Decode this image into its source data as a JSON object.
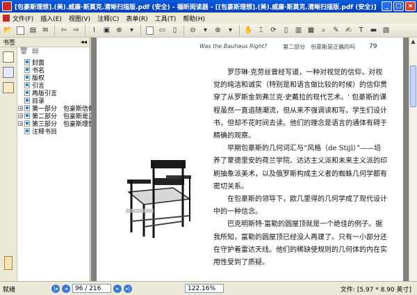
{
  "window": {
    "title": "[包豪斯理想].(美).威廉·斯莫克.清晰扫描版.pdf (安全) - 福昕阅读器 - [[包豪斯理想].(美).威廉·斯莫克.清晰扫描版.pdf (安全)]",
    "minimize": "_",
    "maximize": "□",
    "close": "×"
  },
  "menu": [
    "文件(F)",
    "插入(E)",
    "视图(V)",
    "注释(C)",
    "表单(R)",
    "工具(T)",
    "帮助(H)"
  ],
  "sidebar": {
    "title": "书签",
    "collapse": "◂◂",
    "items": [
      {
        "label": "封面",
        "expandable": false
      },
      {
        "label": "书名",
        "expandable": false
      },
      {
        "label": "版权",
        "expandable": false
      },
      {
        "label": "引言",
        "expandable": false
      },
      {
        "label": "再版引言",
        "expandable": false
      },
      {
        "label": "目录",
        "expandable": false
      },
      {
        "label": "第一部分　包豪斯信仰",
        "expandable": true
      },
      {
        "label": "第二部分　包豪斯是正",
        "expandable": true
      },
      {
        "label": "第三部分　包豪斯理想",
        "expandable": true
      },
      {
        "label": "注释书目",
        "expandable": false
      }
    ]
  },
  "page": {
    "header_en": "Was the Bauhaus Right?",
    "header_section": "第二部分　包豪斯是正确的吗",
    "page_number": "79",
    "paragraphs": [
      "罗莎琳·克劳丝曾经写道，一种对视觉的信仰，对视觉的纯洁和诚实（特别是和语言做比较的时候）的信仰贯穿了从罗斯金到弗兰克·史戴拉的现代艺术。' 包豪斯的课程虽然一直追随潮流，但从来不强调读和写。学生们设计书，但却不花时间去读。他们的理念是语言的通体有碍于精确的观察。",
      "早期包豪斯的几何词汇与“风格（de Stijl）”——培养了蒙德里安的荷兰学院、达达主义派和未来主义派的印刷抽象派美术，以及俄罗斯构成主义者的蜘蛛几何学都有密切关系。",
      "在包豪斯的领导下，欧几里得的几何学成了现代设计中的一种信念。",
      "巴克明斯特·富勒的圆屋顶就是一个绝佳的例子。据我所知，富勒的圆屋顶已经没人再建了。只有一小部分还在守护着雷达天线。他们的稀缺使规则的几何体的内在实用性受到了质疑。"
    ]
  },
  "status": {
    "ready": "就绪",
    "page_indicator": "96 / 216",
    "zoom": "122.16%",
    "doc_size": "文件: [5.97 * 8.90 英寸]"
  },
  "nav_buttons": {
    "first": "|◂",
    "prev": "◂",
    "next": "▸",
    "last": "▸|"
  },
  "colors": {
    "titlebar": "#0a5ddc",
    "viewer_bg": "#808080",
    "chrome": "#ece9d8"
  }
}
